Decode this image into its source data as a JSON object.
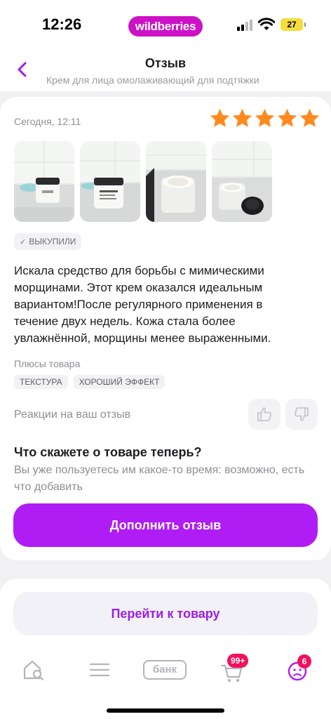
{
  "status_bar": {
    "time": "12:26",
    "brand": "wildberries",
    "battery": "27"
  },
  "header": {
    "title": "Отзыв",
    "subtitle": "Крем для лица омолаживающий для подтяжки"
  },
  "review": {
    "date": "Сегодня, 12:11",
    "rating": 5,
    "bought_badge": "ВЫКУПИЛИ",
    "text": "Искала средство для борьбы с мимическими морщинами. Этот крем оказался идеальным вариантом!После регулярного применения в течение двух недель. Кожа стала более увлажнённой, морщины менее выраженными.",
    "pros_label": "Плюсы товара",
    "tags": [
      "ТЕКСТУРА",
      "ХОРОШИЙ ЭФФЕКТ"
    ],
    "reactions_label": "Реакции на ваш отзыв",
    "prompt_title": "Что скажете о товаре теперь?",
    "prompt_desc": "Вы уже пользуетесь им какое-то время: возможно, есть что добавить",
    "add_button": "Дополнить отзыв"
  },
  "goto_button": "Перейти к товару",
  "tab_bar": {
    "bank_label": "банк",
    "cart_badge": "99+",
    "profile_badge": "6"
  },
  "colors": {
    "accent": "#b01cf4",
    "brand": "#cc11c7",
    "star": "#ff8a1e",
    "badge": "#f1115c"
  }
}
